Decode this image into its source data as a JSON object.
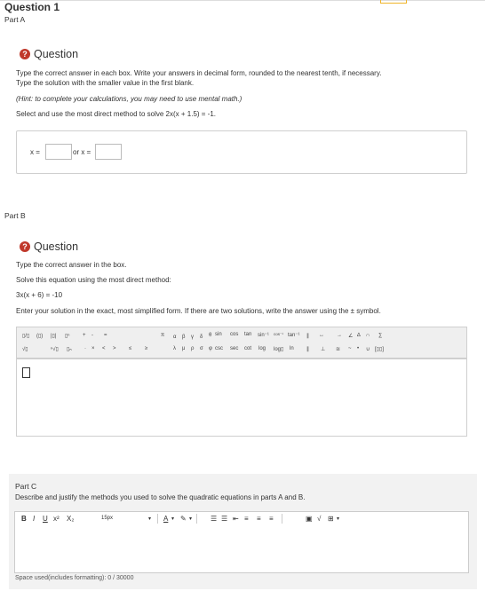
{
  "header": {
    "question_title": "Question 1",
    "part_a": "Part A",
    "part_b": "Part B"
  },
  "partA": {
    "heading": "Question",
    "instr1": "Type the correct answer in each box. Write your answers in decimal form, rounded to the nearest tenth, if necessary.",
    "instr2": "Type the solution with the smaller value in the first blank.",
    "hint": "(Hint: to complete your calculations, you may need to use mental math.)",
    "prompt": "Select and use the most direct method to solve 2x(x + 1.5) = -1.",
    "label_x1": "x =",
    "label_or": "or x ="
  },
  "partB": {
    "heading": "Question",
    "instr1": "Type the correct answer in the box.",
    "instr2": "Solve this equation using the most direct method:",
    "equation": "3x(x + 6) = -10",
    "instr3": "Enter your solution in the exact, most simplified form. If there are two solutions, write the answer using the ± symbol.",
    "toolbar_row1_left": [
      "▯/▯",
      "(▯)",
      "|▯|",
      "▯ⁿ",
      "+",
      "-",
      "="
    ],
    "toolbar_row2_left": [
      "√▯",
      "ⁿ√▯",
      "▯ₙ",
      "·",
      "×",
      "<",
      ">",
      "≤",
      "≥"
    ],
    "toolbar_row1_greek": [
      "π",
      "α",
      "β",
      "γ",
      "δ",
      "θ"
    ],
    "toolbar_row2_greek": [
      "λ",
      "μ",
      "ρ",
      "σ",
      "φ"
    ],
    "toolbar_row1_trig": [
      "sin",
      "cos",
      "tan",
      "sin⁻¹",
      "cos⁻¹",
      "tan⁻¹"
    ],
    "toolbar_row2_trig": [
      "csc",
      "sec",
      "cot",
      "log",
      "log▯",
      "ln"
    ],
    "toolbar_row1_sym": [
      "∥",
      "↔",
      "→",
      "∠",
      "∆",
      "∩",
      "∑"
    ],
    "toolbar_row2_sym": [
      "∥",
      "⊥",
      "≅",
      "~",
      "•",
      "∪",
      "[▯▯]"
    ]
  },
  "partC": {
    "title": "Part C",
    "prompt": "Describe and justify the methods you used to solve the quadratic equations in parts A and B.",
    "font_size": "15px",
    "space_used": "Space used(includes formatting): 0 / 30000"
  }
}
